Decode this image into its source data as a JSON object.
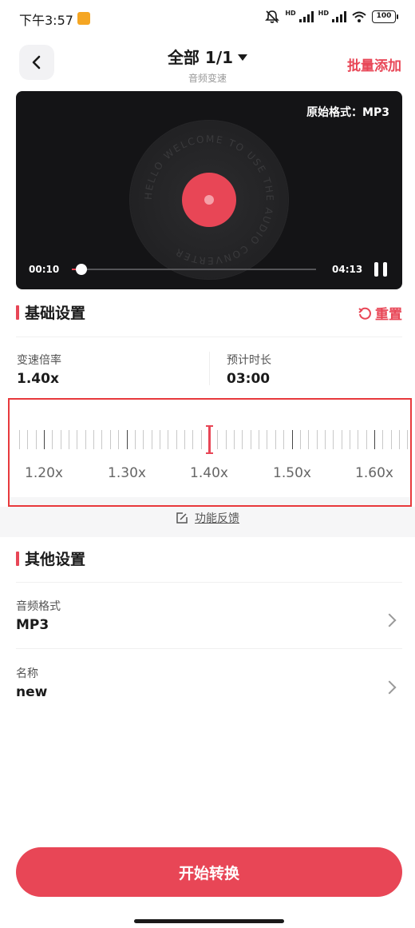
{
  "status_bar": {
    "time": "下午3:57",
    "hd1": "HD",
    "hd2": "HD",
    "battery": "100"
  },
  "header": {
    "title": "全部 1/1",
    "subtitle": "音频变速",
    "batch_add_label": "批量添加"
  },
  "player": {
    "original_format": "原始格式：MP3",
    "vinyl_ring_text": "HELLO WELCOME TO USE THE AUDIO CONVERTER",
    "current_time": "00:10",
    "total_time": "04:13",
    "progress": 0.04
  },
  "basic": {
    "title": "基础设置",
    "reset_label": "重置",
    "speed_label": "变速倍率",
    "speed_value": "1.40x",
    "duration_label": "预计时长",
    "duration_value": "03:00"
  },
  "ruler": {
    "labels": [
      "1.20x",
      "1.30x",
      "1.40x",
      "1.50x",
      "1.60x"
    ],
    "selected": "1.40x"
  },
  "feedback": {
    "label": "功能反馈"
  },
  "other": {
    "title": "其他设置",
    "rows": [
      {
        "label": "音频格式",
        "value": "MP3"
      },
      {
        "label": "名称",
        "value": "new"
      }
    ]
  },
  "action": {
    "start_label": "开始转换"
  },
  "colors": {
    "accent": "#e84656",
    "player_bg": "#141416",
    "highlight_border": "#e8393c"
  }
}
